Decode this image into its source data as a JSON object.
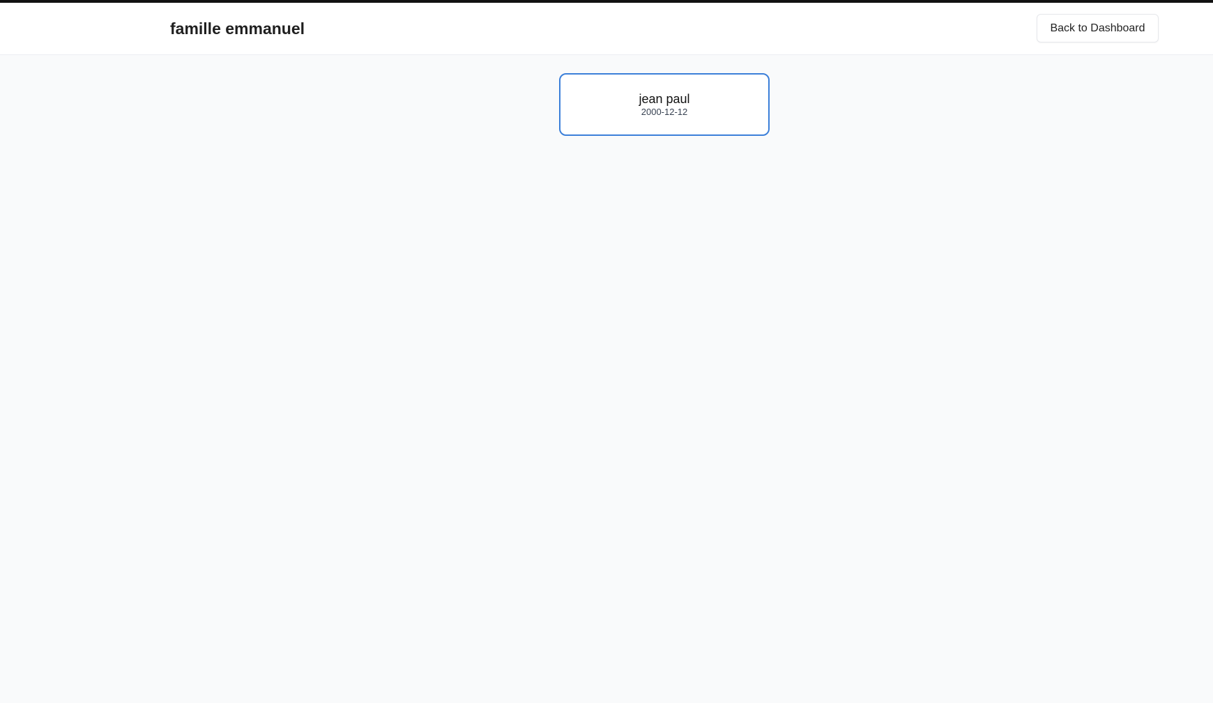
{
  "header": {
    "title": "famille emmanuel",
    "back_button_label": "Back to Dashboard"
  },
  "tree": {
    "people": [
      {
        "name": "jean paul",
        "date": "2000-12-12"
      }
    ]
  },
  "colors": {
    "card_border": "#3b7fd9",
    "page_background": "#f9fafb",
    "header_background": "#ffffff",
    "top_rule": "#111111"
  }
}
